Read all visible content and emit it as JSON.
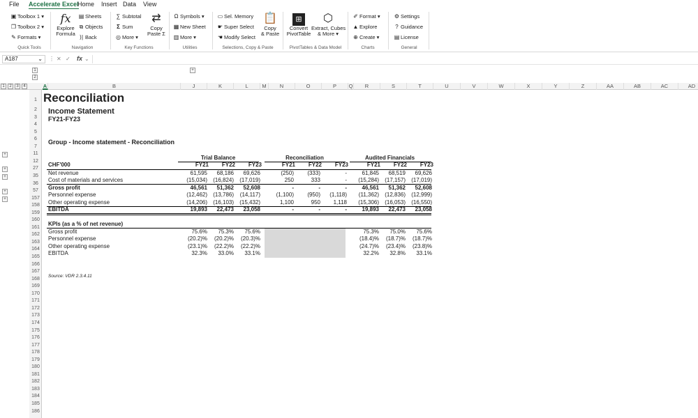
{
  "menu": [
    "File",
    "Accelerate Excel",
    "Home",
    "Insert",
    "Data",
    "View"
  ],
  "ribbon": {
    "quick_tools": {
      "items": [
        "Toolbox 1",
        "Toolbox 2",
        "Formats"
      ],
      "label": "Quick Tools"
    },
    "navigation": {
      "explore": "Explore",
      "formula": "Formula",
      "items": [
        "Sheets",
        "Objects",
        "Back"
      ],
      "label": "Navigation"
    },
    "key_functions": {
      "items": [
        "Subtotal",
        "Sum",
        "More"
      ],
      "copy": "Copy",
      "paste": "Paste Σ",
      "label": "Key Functions"
    },
    "utilities": {
      "items": [
        "Symbols",
        "New Sheet",
        "More"
      ],
      "label": "Utilities"
    },
    "selections": {
      "items": [
        "Sel. Memory",
        "Super Select",
        "Modify Select"
      ],
      "copy": "Copy",
      "paste": "& Paste",
      "label": "Selections, Copy & Paste"
    },
    "pivot": {
      "convert": "Convert",
      "pivottable": "PivotTable",
      "extract": "Extract, Cubes",
      "more": "& More",
      "label": "PivotTables & Data Model"
    },
    "charts": {
      "items": [
        "Format",
        "Explore",
        "Create"
      ],
      "label": "Charts"
    },
    "general": {
      "items": [
        "Settings",
        "Guidance",
        "License"
      ],
      "label": "General"
    }
  },
  "formula_bar": {
    "name_box": "A187",
    "fx": "fx",
    "formula": ""
  },
  "outline_levels": [
    "1",
    "2",
    "3",
    "4"
  ],
  "columns": [
    {
      "l": "A",
      "sel": true
    },
    {
      "l": "B"
    },
    {
      "l": "J"
    },
    {
      "l": "K"
    },
    {
      "l": "L"
    },
    {
      "l": "M"
    },
    {
      "l": "N"
    },
    {
      "l": "O"
    },
    {
      "l": "P"
    },
    {
      "l": "Q"
    },
    {
      "l": "R"
    },
    {
      "l": "S"
    },
    {
      "l": "T"
    },
    {
      "l": "U"
    },
    {
      "l": "V"
    },
    {
      "l": "W"
    },
    {
      "l": "X"
    },
    {
      "l": "Y"
    },
    {
      "l": "Z"
    },
    {
      "l": "AA"
    },
    {
      "l": "AB"
    },
    {
      "l": "AC"
    },
    {
      "l": "AD"
    }
  ],
  "rows": [
    "1",
    "2",
    "3",
    "4",
    "5",
    "6",
    "7",
    "11",
    "12",
    "27",
    "35",
    "36",
    "57",
    "157",
    "158",
    "159",
    "160",
    "161",
    "162",
    "163",
    "164",
    "165",
    "166",
    "167",
    "168",
    "169",
    "170",
    "171",
    "172",
    "173",
    "174",
    "175",
    "176",
    "177",
    "178",
    "179",
    "180",
    "181",
    "182",
    "183",
    "184",
    "185",
    "186"
  ],
  "sheet": {
    "title": "Reconciliation",
    "subtitle": "Income Statement",
    "period": "FY21-FY23",
    "section": "Group - Income statement - Reconciliation",
    "group_headers": [
      "Trial Balance",
      "Reconciliation",
      "Audited Financials"
    ],
    "unit_label": "CHF'000",
    "year_headers": [
      "FY21",
      "FY22",
      "FY23",
      "FY21",
      "FY22",
      "FY23",
      "FY21",
      "FY22",
      "FY23"
    ],
    "lines": [
      {
        "label": "Net revenue",
        "tb": [
          "61,595",
          "68,186",
          "69,626"
        ],
        "rec": [
          "(250)",
          "(333)",
          "-"
        ],
        "af": [
          "61,845",
          "68,519",
          "69,626"
        ],
        "bold": false
      },
      {
        "label": "Cost of materials and services",
        "tb": [
          "(15,034)",
          "(16,824)",
          "(17,019)"
        ],
        "rec": [
          "250",
          "333",
          "-"
        ],
        "af": [
          "(15,284)",
          "(17,157)",
          "(17,019)"
        ],
        "bold": false
      },
      {
        "label": "Gross profit",
        "tb": [
          "46,561",
          "51,362",
          "52,608"
        ],
        "rec": [
          "-",
          "-",
          "-"
        ],
        "af": [
          "46,561",
          "51,362",
          "52,608"
        ],
        "bold": true
      },
      {
        "label": "Personnel expense",
        "tb": [
          "(12,462)",
          "(13,786)",
          "(14,117)"
        ],
        "rec": [
          "(1,100)",
          "(950)",
          "(1,118)"
        ],
        "af": [
          "(11,362)",
          "(12,836)",
          "(12,999)"
        ],
        "bold": false
      },
      {
        "label": "Other operating expense",
        "tb": [
          "(14,206)",
          "(16,103)",
          "(15,432)"
        ],
        "rec": [
          "1,100",
          "950",
          "1,118"
        ],
        "af": [
          "(15,306)",
          "(16,053)",
          "(16,550)"
        ],
        "bold": false
      },
      {
        "label": "EBITDA",
        "tb": [
          "19,893",
          "22,473",
          "23,058"
        ],
        "rec": [
          "-",
          "-",
          "-"
        ],
        "af": [
          "19,893",
          "22,473",
          "23,058"
        ],
        "bold": true
      }
    ],
    "kpi_title": "KPIs (as a % of net revenue)",
    "kpis": [
      {
        "label": "Gross profit",
        "tb": [
          "75.6%",
          "75.3%",
          "75.6%"
        ],
        "af": [
          "75.3%",
          "75.0%",
          "75.6%"
        ]
      },
      {
        "label": "Personnel expense",
        "tb": [
          "(20.2)%",
          "(20.2)%",
          "(20.3)%"
        ],
        "af": [
          "(18.4)%",
          "(18.7)%",
          "(18.7)%"
        ]
      },
      {
        "label": "Other operating expense",
        "tb": [
          "(23.1)%",
          "(22.2)%",
          "(22.2)%"
        ],
        "af": [
          "(24.7)%",
          "(23.4)%",
          "(23.8)%"
        ]
      },
      {
        "label": "EBITDA",
        "tb": [
          "32.3%",
          "33.0%",
          "33.1%"
        ],
        "af": [
          "32.2%",
          "32.8%",
          "33.1%"
        ]
      }
    ],
    "source": "Source: VDR 2.3.4.11"
  },
  "colors": {
    "accent": "#1e7145",
    "grey_fill": "#d9d9d9"
  }
}
